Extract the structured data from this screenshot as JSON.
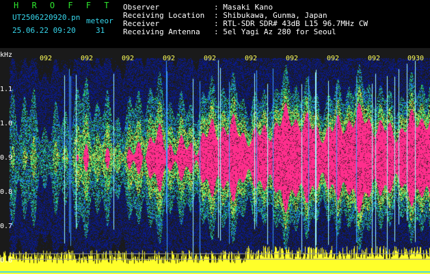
{
  "header": {
    "station": "H R O F F T",
    "filename": "UT2506220920.pn",
    "type": "meteor",
    "datetime": "25.06.22 09:20",
    "count": "31",
    "info_labels": [
      "Observer",
      "Receiving Location",
      "Receiver",
      "Receiving Antenna"
    ],
    "info_values": [
      ": Masaki Kano",
      ": Shibukawa, Gunma, Japan",
      ": RTL-SDR SDR# 43dB L15 96.7MHz CW",
      ": 5el Yagi Az 280 for Seoul"
    ]
  },
  "axis": {
    "unit": "kHz",
    "y_ticks": [
      "1.1",
      "1.0",
      "0.9",
      "0.8",
      "0.7",
      "0.6"
    ],
    "time_ticks": [
      "092",
      "092",
      "092",
      "092",
      "092",
      "092",
      "092",
      "092",
      "092",
      "0930"
    ]
  },
  "colors": {
    "noise": "#0a1a8c",
    "signal_green": "#2bd67a",
    "signal_magenta": "#ff2e8c",
    "noise_bar": "#ffff2a"
  }
}
